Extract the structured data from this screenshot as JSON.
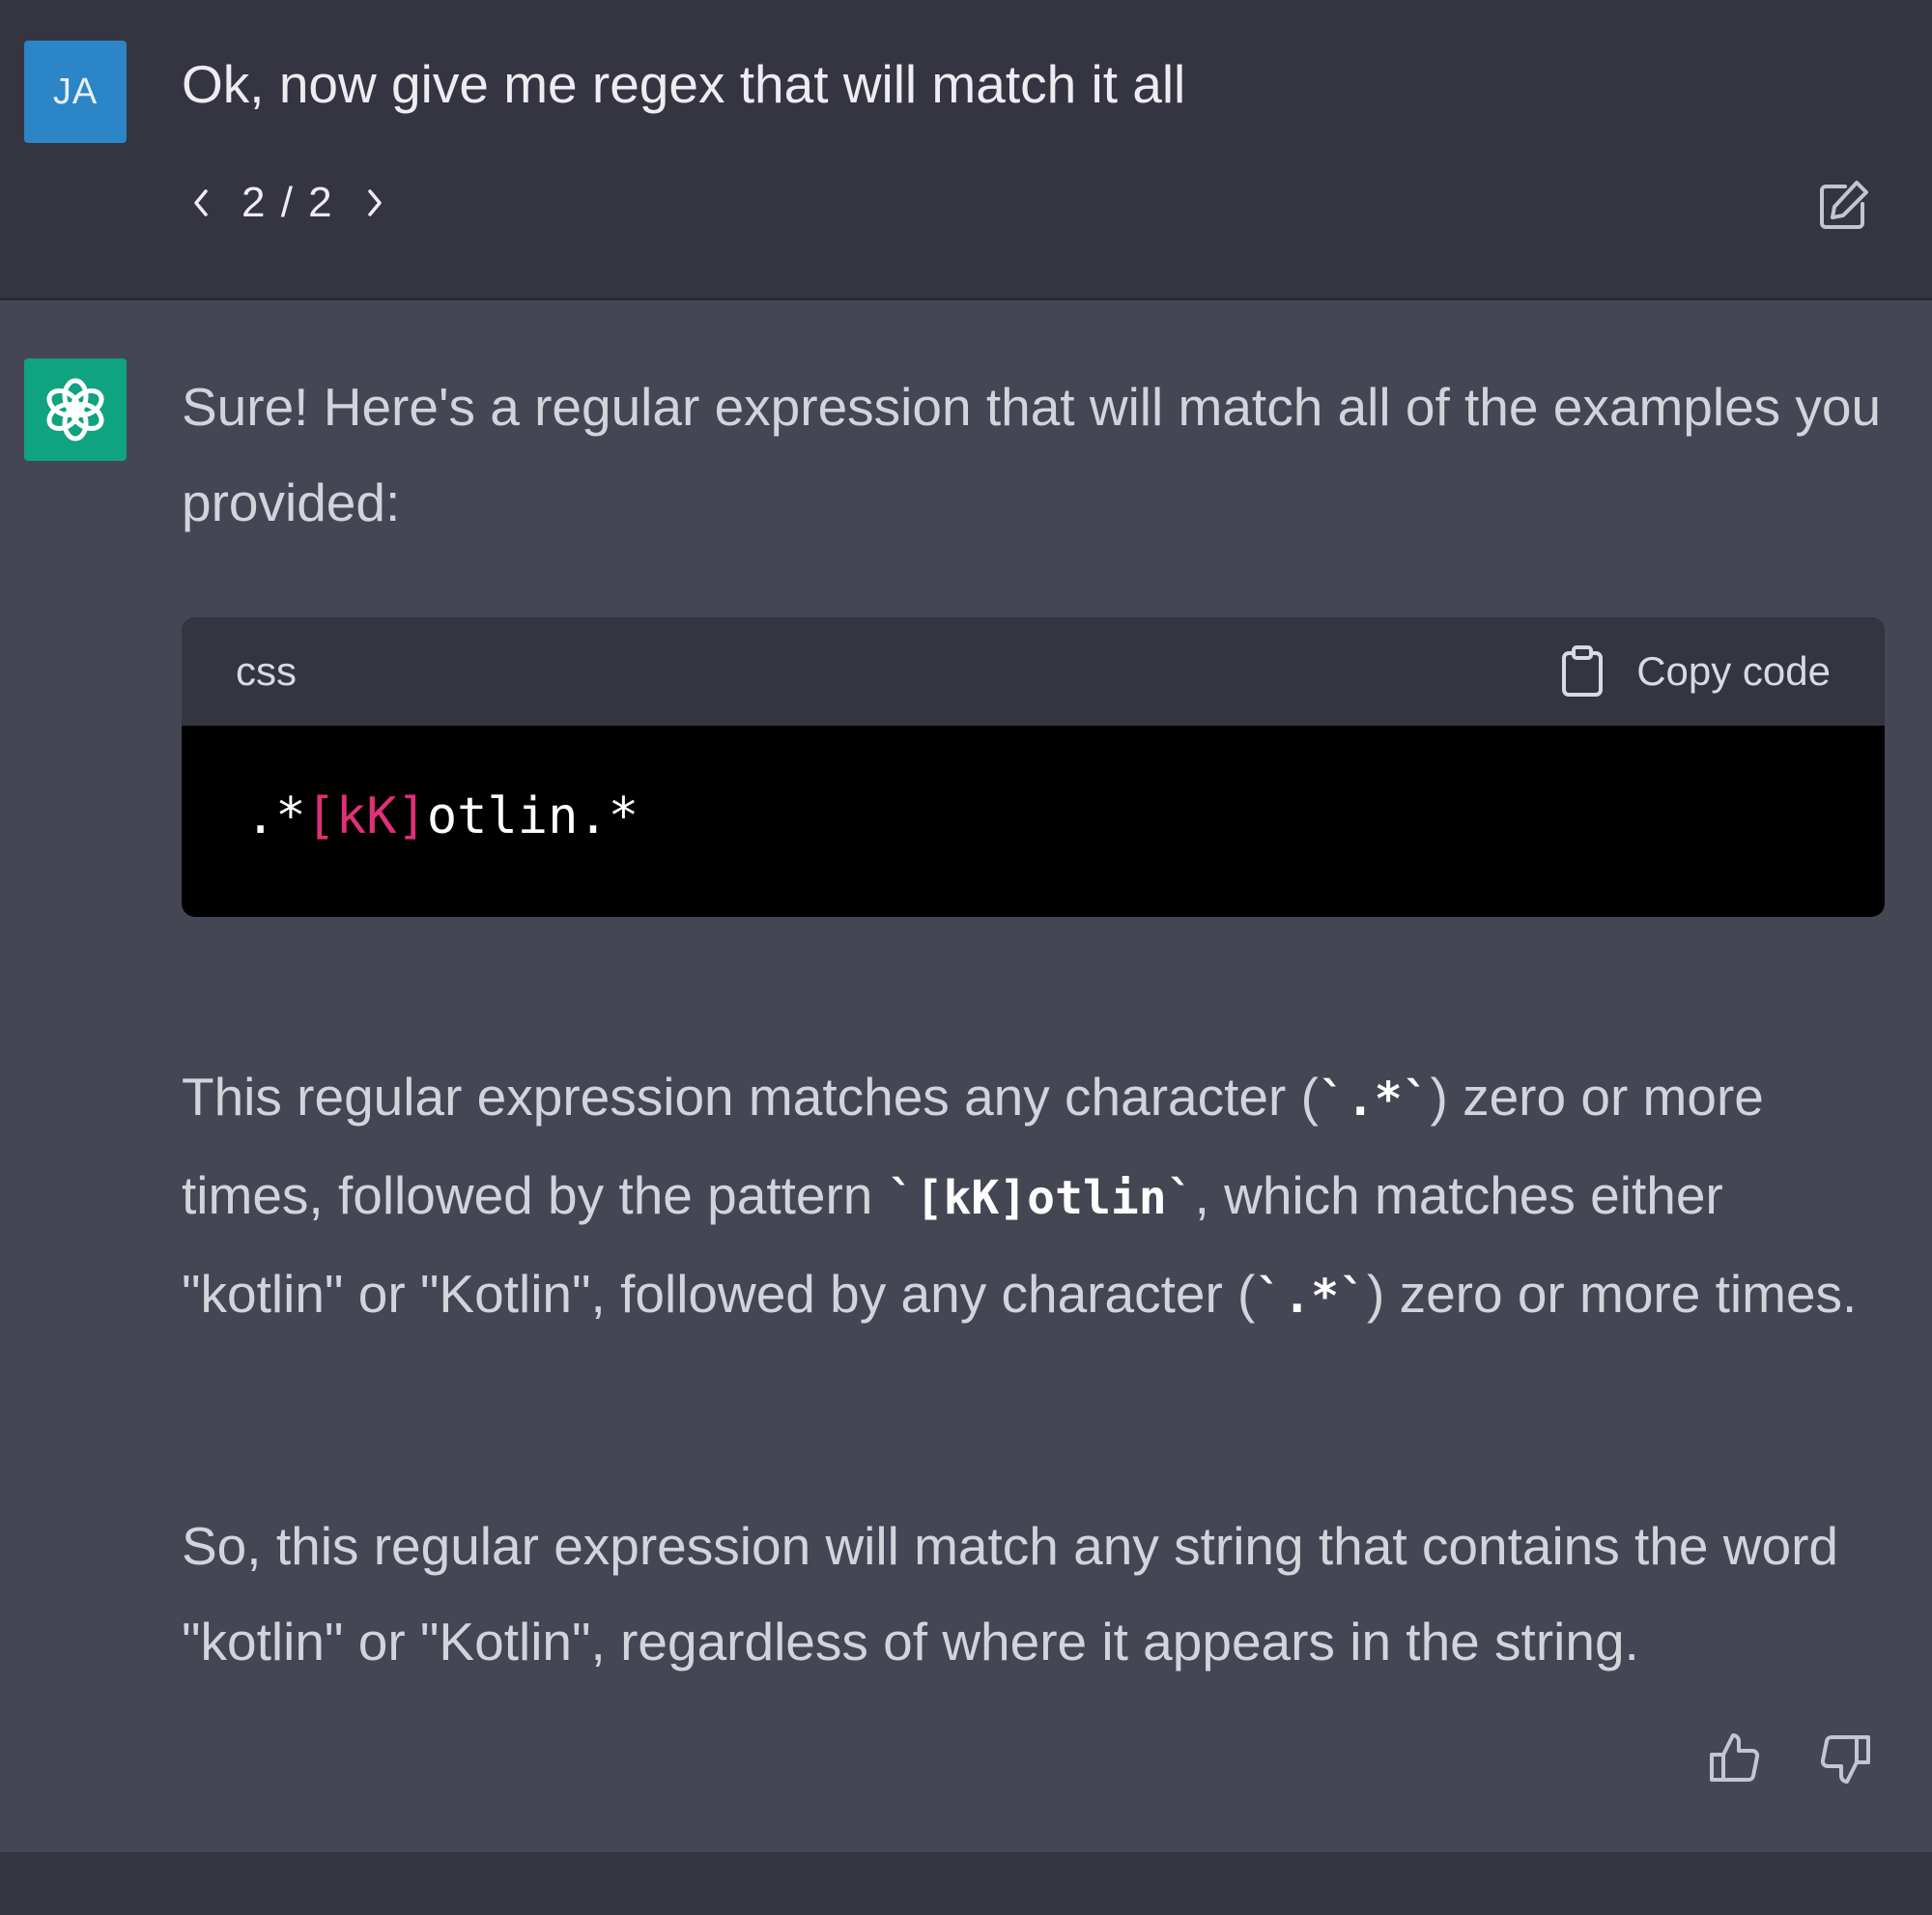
{
  "user_message": {
    "avatar_initials": "JA",
    "text": "Ok, now give me regex that will match it all",
    "pager": {
      "current": "2",
      "separator": "/",
      "total": "2",
      "label": "2 / 2"
    },
    "avatar_color": "#2b85c7"
  },
  "assistant_message": {
    "avatar_color": "#10a37f",
    "intro": "Sure! Here's a regular expression that will match all of the examples you provided:",
    "code_block": {
      "language": "css",
      "copy_label": "Copy code",
      "code_prefix": ".*",
      "code_class": "[kK]",
      "code_suffix": "otlin.*",
      "class_color": "#df3079"
    },
    "explanation": {
      "part1": "This regular expression matches any character (",
      "code1": "`.*`",
      "part2": ") zero or more times, followed by the pattern ",
      "code2": "`[kK]otlin`",
      "part3": ", which matches either \"kotlin\" or \"Kotlin\", followed by any character (",
      "code3": "`.*`",
      "part4": ") zero or more times."
    },
    "summary": "So, this regular expression will match any string that contains the word \"kotlin\" or \"Kotlin\", regardless of where it appears in the string."
  },
  "icons": {
    "prev": "chevron-left-icon",
    "next": "chevron-right-icon",
    "edit": "edit-icon",
    "copy": "clipboard-icon",
    "like": "thumbs-up-icon",
    "dislike": "thumbs-down-icon",
    "bot": "openai-logo-icon"
  }
}
